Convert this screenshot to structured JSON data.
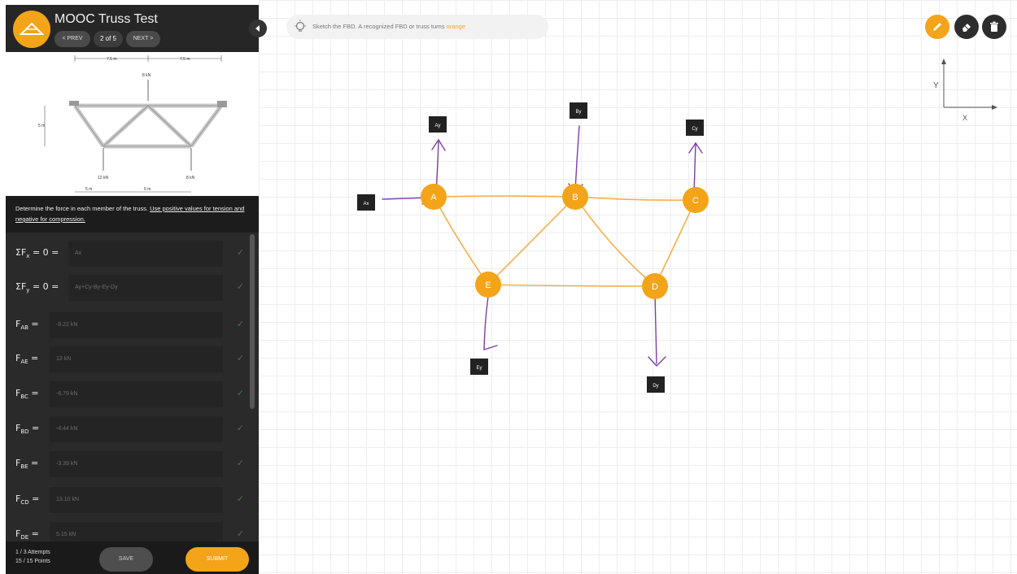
{
  "header": {
    "title": "MOOC Truss Test",
    "prev_label": "< PREV",
    "page_indicator": "2 of 5",
    "next_label": "NEXT >"
  },
  "figure": {
    "dims": [
      "7.5 m",
      "7.5 m",
      "5 m",
      "5 m",
      "6 m"
    ],
    "loads": [
      "8 kN",
      "12 kN",
      "8 kN"
    ]
  },
  "instructions": {
    "text": "Determine the force in each member of the truss. ",
    "underlined": "Use positive values for tension and negative for compression."
  },
  "equations": [
    {
      "base": "ΣF",
      "sub": "x",
      "suffix": " = 0 = ",
      "value": "Ax"
    },
    {
      "base": "ΣF",
      "sub": "y",
      "suffix": " = 0 = ",
      "value": "Ay+Cy-By-Ey-Dy"
    },
    {
      "base": "F",
      "sub": "AB",
      "suffix": " = ",
      "value": "-8.22 kN"
    },
    {
      "base": "F",
      "sub": "AE",
      "suffix": " = ",
      "value": "13 kN"
    },
    {
      "base": "F",
      "sub": "BC",
      "suffix": " = ",
      "value": "-6.79 kN"
    },
    {
      "base": "F",
      "sub": "BD",
      "suffix": " = ",
      "value": "-4.44 kN"
    },
    {
      "base": "F",
      "sub": "BE",
      "suffix": " = ",
      "value": "-3.39 kN"
    },
    {
      "base": "F",
      "sub": "CD",
      "suffix": " = ",
      "value": "13.10 kN"
    },
    {
      "base": "F",
      "sub": "DE",
      "suffix": " = ",
      "value": "5.15 kN"
    }
  ],
  "footer": {
    "attempts": "1 / 3 Attempts",
    "points": "15 / 15 Points",
    "save_label": "SAVE",
    "submit_label": "SUBMIT"
  },
  "hint": {
    "text": "Sketch the FBD. A recognized FBD or truss turns ",
    "highlight": "orange"
  },
  "axes": {
    "y_label": "Y",
    "x_label": "X"
  },
  "diagram": {
    "nodes": [
      {
        "id": "A",
        "label": "A"
      },
      {
        "id": "B",
        "label": "B"
      },
      {
        "id": "C",
        "label": "C"
      },
      {
        "id": "D",
        "label": "D"
      },
      {
        "id": "E",
        "label": "E"
      }
    ],
    "force_labels": [
      "Ax",
      "Ay",
      "By",
      "Cy",
      "Ey",
      "Dy"
    ]
  },
  "colors": {
    "accent": "#f4a418",
    "force_arrow": "#7a3fa8",
    "sidebar": "#1f1f1f"
  },
  "icons": [
    "pencil-icon",
    "eraser-icon",
    "trash-icon",
    "lightbulb-icon",
    "collapse-chevron-icon",
    "logo-icon",
    "check-icon"
  ]
}
